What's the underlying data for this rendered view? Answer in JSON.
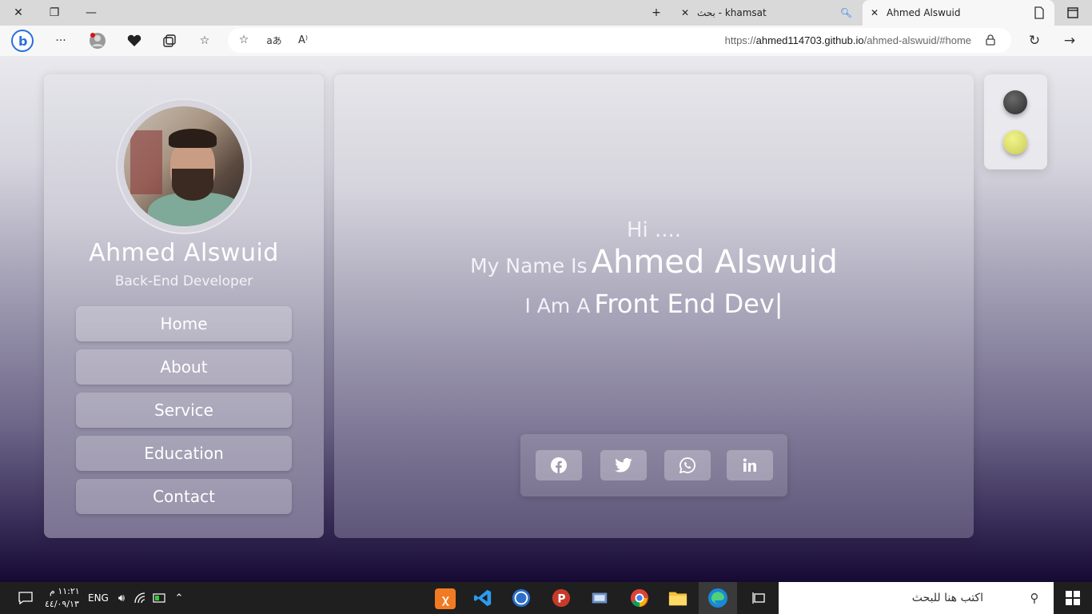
{
  "browser": {
    "tabs": [
      {
        "title": "khamsat - بحث",
        "active": false
      },
      {
        "title": "Ahmed Alswuid",
        "active": true
      }
    ],
    "url_prefix": "https://",
    "url_host": "ahmed114703.github.io",
    "url_path": "/ahmed-alswuid/#home",
    "icons": [
      "close-icon",
      "restore-icon",
      "minimize-icon",
      "new-tab-icon",
      "search-icon",
      "page-icon",
      "tab-actions-icon",
      "bing-icon",
      "more-icon",
      "profile-icon",
      "health-icon",
      "collections-icon",
      "favorites-icon",
      "add-favorite-icon",
      "translate-icon",
      "read-aloud-icon",
      "lock-icon",
      "refresh-icon",
      "forward-icon"
    ]
  },
  "sidebar": {
    "name": "Ahmed Alswuid",
    "role": "Back-End Developer",
    "nav": [
      {
        "label": "Home"
      },
      {
        "label": "About"
      },
      {
        "label": "Service"
      },
      {
        "label": "Education"
      },
      {
        "label": "Contact"
      }
    ]
  },
  "hero": {
    "greeting": "Hi ....",
    "name_prefix": "My Name Is",
    "name": "Ahmed Alswuid",
    "role_prefix": "I Am A",
    "role": "Front End Dev|"
  },
  "social": [
    "facebook-icon",
    "twitter-icon",
    "whatsapp-icon",
    "linkedin-icon"
  ],
  "theme_switcher": {
    "colors": {
      "dark": "#3a3a3a",
      "light": "#e3e67a"
    }
  },
  "taskbar": {
    "time": "١١:٢١ م",
    "date": "٤٤/٠٩/١٣",
    "lang": "ENG",
    "search_placeholder": "اكتب هنا للبحث"
  }
}
